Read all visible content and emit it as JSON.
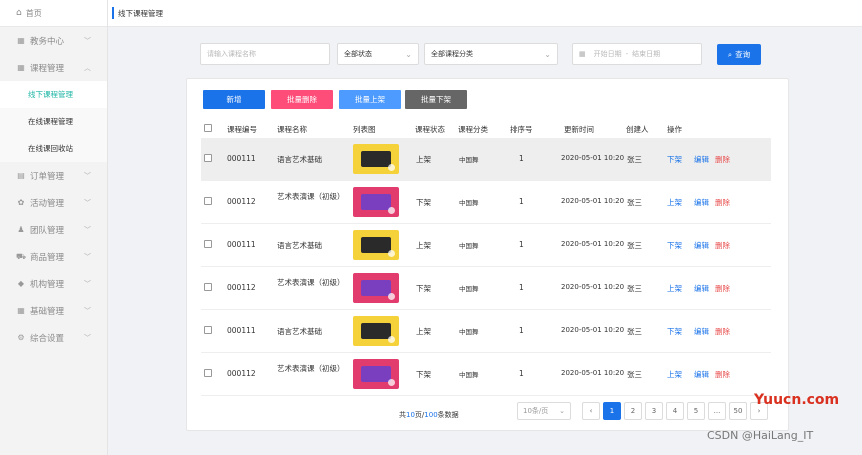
{
  "sidebar": {
    "home": "首页",
    "menus": [
      {
        "label": "教务中心",
        "icon": "grid-icon"
      },
      {
        "label": "课程管理",
        "icon": "grid-icon",
        "expanded": true,
        "children": [
          "线下课程管理",
          "在线课程管理",
          "在线课回收站"
        ]
      },
      {
        "label": "订单管理",
        "icon": "doc-icon"
      },
      {
        "label": "活动管理",
        "icon": "gift-icon"
      },
      {
        "label": "团队管理",
        "icon": "team-icon"
      },
      {
        "label": "商品管理",
        "icon": "cart-icon"
      },
      {
        "label": "机构管理",
        "icon": "cap-icon"
      },
      {
        "label": "基础管理",
        "icon": "grid-icon"
      },
      {
        "label": "综合设置",
        "icon": "gear-icon"
      }
    ],
    "active_child": "线下课程管理"
  },
  "topbar": {
    "tab": "线下课程管理"
  },
  "filters": {
    "search_placeholder": "请输入课程名称",
    "status": "全部状态",
    "category": "全部课程分类",
    "date_start": "开始日期",
    "date_sep": "-",
    "date_end": "结束日期",
    "search_btn": "查询"
  },
  "actions": {
    "add": "新增",
    "batch_delete": "批量删除",
    "batch_on": "批量上架",
    "batch_off": "批量下架"
  },
  "colors": {
    "primary": "#1a73e8",
    "danger": "#ff4d7a",
    "light_blue": "#4d9bff",
    "gray": "#666666",
    "active_menu": "#1fb6a6"
  },
  "table": {
    "headers": [
      "课程编号",
      "课程名称",
      "列表图",
      "课程状态",
      "课程分类",
      "排序号",
      "更新时间",
      "创建人",
      "操作"
    ],
    "rows": [
      {
        "id": "000111",
        "name": "语言艺术基础",
        "status": "上架",
        "category": "中国舞",
        "sort": "1",
        "time": "2020-05-01 10:20",
        "creator": "张三",
        "toggle": "下架",
        "edit": "编辑",
        "del": "删除",
        "thumb": "t1"
      },
      {
        "id": "000112",
        "name": "艺术表演课（初级）",
        "status": "下架",
        "category": "中国舞",
        "sort": "1",
        "time": "2020-05-01 10:20",
        "creator": "张三",
        "toggle": "上架",
        "edit": "编辑",
        "del": "删除",
        "thumb": "t2"
      },
      {
        "id": "000111",
        "name": "语言艺术基础",
        "status": "上架",
        "category": "中国舞",
        "sort": "1",
        "time": "2020-05-01 10:20",
        "creator": "张三",
        "toggle": "下架",
        "edit": "编辑",
        "del": "删除",
        "thumb": "t1"
      },
      {
        "id": "000112",
        "name": "艺术表演课（初级）",
        "status": "下架",
        "category": "中国舞",
        "sort": "1",
        "time": "2020-05-01 10:20",
        "creator": "张三",
        "toggle": "上架",
        "edit": "编辑",
        "del": "删除",
        "thumb": "t2"
      },
      {
        "id": "000111",
        "name": "语言艺术基础",
        "status": "上架",
        "category": "中国舞",
        "sort": "1",
        "time": "2020-05-01 10:20",
        "creator": "张三",
        "toggle": "下架",
        "edit": "编辑",
        "del": "删除",
        "thumb": "t1"
      },
      {
        "id": "000112",
        "name": "艺术表演课（初级）",
        "status": "下架",
        "category": "中国舞",
        "sort": "1",
        "time": "2020-05-01 10:20",
        "creator": "张三",
        "toggle": "上架",
        "edit": "编辑",
        "del": "删除",
        "thumb": "t2"
      }
    ]
  },
  "pagination": {
    "total_prefix": "共",
    "pages": "10",
    "pages_unit": "页/",
    "items": "100",
    "items_unit": "条数据",
    "page_size": "10条/页",
    "buttons": [
      "‹",
      "1",
      "2",
      "3",
      "4",
      "5",
      "...",
      "50",
      "›"
    ],
    "current": "1"
  },
  "watermark": {
    "site": "Yuucn.com",
    "author": "CSDN @HaiLang_IT"
  }
}
